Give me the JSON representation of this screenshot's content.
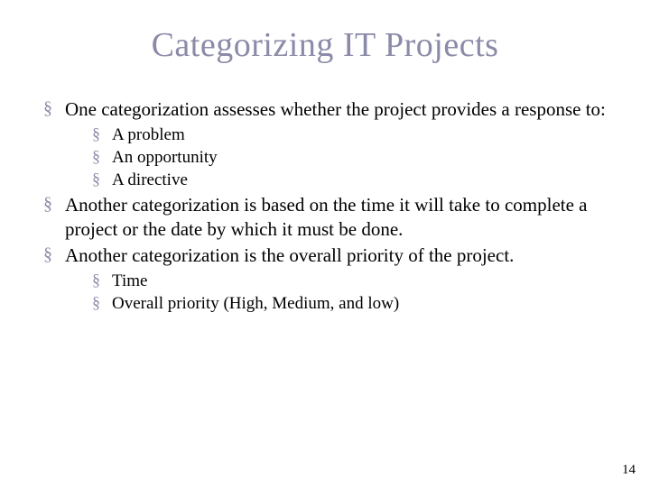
{
  "title": "Categorizing IT Projects",
  "bullets": [
    {
      "text": "One categorization assesses whether the project provides a response to:",
      "children": [
        {
          "text": "A problem"
        },
        {
          "text": "An opportunity"
        },
        {
          "text": "A directive"
        }
      ]
    },
    {
      "text": "Another categorization is based on the time it will take to complete a project or the date by which it must be done."
    },
    {
      "text": "Another categorization is the overall priority of the project.",
      "children": [
        {
          "text": "Time"
        },
        {
          "text": "Overall priority (High, Medium, and low)"
        }
      ]
    }
  ],
  "page_number": "14"
}
